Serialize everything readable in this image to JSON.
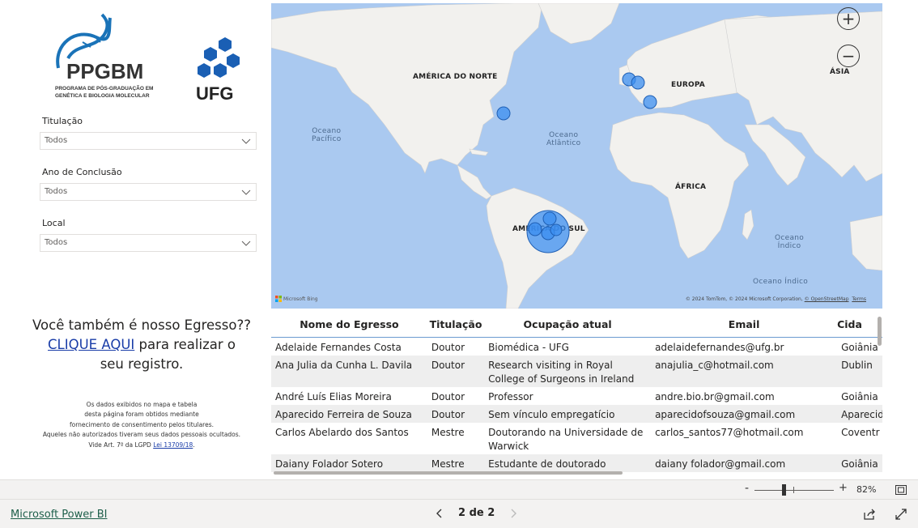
{
  "logos": {
    "ppgbm_name": "PPGBM",
    "ppgbm_line1": "PROGRAMA DE PÓS-GRADUAÇÃO EM",
    "ppgbm_line2": "GENÉTICA E BIOLOGIA MOLECULAR",
    "ufg_name": "UFG"
  },
  "filters": [
    {
      "label": "Titulação",
      "value": "Todos"
    },
    {
      "label": "Ano de Conclusão",
      "value": "Todos"
    },
    {
      "label": "Local",
      "value": "Todos"
    }
  ],
  "cta": {
    "line1": "Você também é nosso Egresso??",
    "link": "CLIQUE AQUI",
    "line2": " para realizar o",
    "line3": "seu registro."
  },
  "lgpd": {
    "line1": "Os dados exibidos no mapa e tabela",
    "line2": "desta página foram obtidos mediante",
    "line3": "fornecimento de consentimento pelos titulares.",
    "line4": "Aqueles não autorizados tiveram seus dados pessoais ocultados.",
    "line5_prefix": "Vide Art. 7º da LGPD ",
    "line5_link": "Lei 13709/18",
    "line5_suffix": "."
  },
  "map": {
    "zoom_in": "+",
    "zoom_out": "−",
    "labels": {
      "north_america": "AMÉRICA DO NORTE",
      "europe": "EUROPA",
      "asia": "ÁSIA",
      "africa": "ÁFRICA",
      "south_america": "AMÉRICA DO SUL"
    },
    "oceans": {
      "pacific_1": "Oceano",
      "pacific_2": "Pacífico",
      "atlantic_1": "Oceano",
      "atlantic_2": "Atlântico",
      "indian1_1": "Oceano",
      "indian1_2": "Índico",
      "indian2": "Oceano Índico"
    },
    "bing": "Microsoft Bing",
    "copyright_text": "© 2024 TomTom, © 2024 Microsoft Corporation, ",
    "copyright_osm": "© OpenStreetMap",
    "copyright_terms": "Terms",
    "bubble_color": "#3b8ef0"
  },
  "table": {
    "headers": [
      "Nome do Egresso",
      "Titulação",
      "Ocupação atual",
      "Email",
      "Cida"
    ],
    "rows": [
      [
        "Adelaide Fernandes Costa",
        "Doutor",
        "Biomédica - UFG",
        "adelaidefernandes@ufg.br",
        "Goiânia"
      ],
      [
        "Ana Julia da Cunha L. Davila",
        "Doutor",
        "Research visiting in Royal College of Surgeons in Ireland",
        "anajulia_c@hotmail.com",
        "Dublin"
      ],
      [
        "André Luís Elias Moreira",
        "Doutor",
        "Professor",
        "andre.bio.br@gmail.com",
        "Goiânia"
      ],
      [
        "Aparecido Ferreira de Souza",
        "Doutor",
        "Sem vínculo empregatício",
        "aparecidofsouza@gmail.com",
        "Aparecid Goiânia"
      ],
      [
        "Carlos Abelardo dos Santos",
        "Mestre",
        "Doutorando na Universidade de Warwick",
        "carlos_santos77@hotmail.com",
        "Coventr Inglater"
      ],
      [
        "Daiany Folador Sotero",
        "Mestre",
        "Estudante de doutorado",
        "daiany folador@gmail.com",
        "Goiânia"
      ]
    ]
  },
  "zoom": {
    "minus": "-",
    "plus": "+",
    "percent": "82%"
  },
  "footer": {
    "brand": "Microsoft Power BI",
    "page": "2 de 2"
  }
}
